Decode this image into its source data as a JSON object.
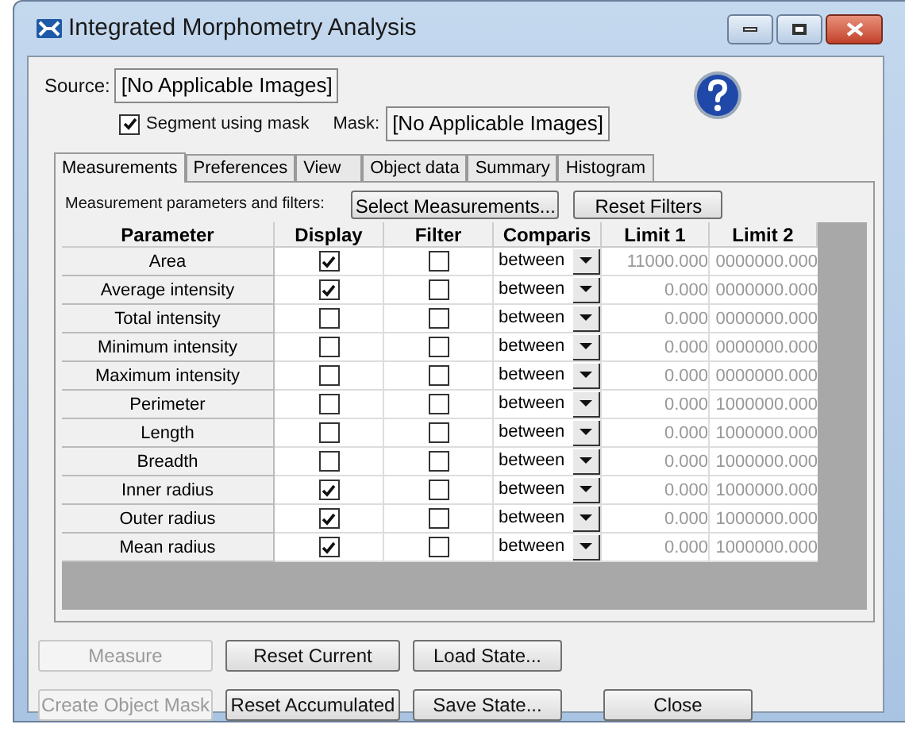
{
  "window": {
    "title": "Integrated Morphometry Analysis"
  },
  "source": {
    "label": "Source:",
    "value": "[No Applicable Images]"
  },
  "segment_using_mask": {
    "label": "Segment using mask",
    "checked": true
  },
  "mask": {
    "label": "Mask:",
    "value": "[No Applicable Images]"
  },
  "tabs": [
    {
      "label": "Measurements",
      "selected": true
    },
    {
      "label": "Preferences",
      "selected": false
    },
    {
      "label": "View",
      "selected": false
    },
    {
      "label": "Object data",
      "selected": false
    },
    {
      "label": "Summary",
      "selected": false
    },
    {
      "label": "Histogram",
      "selected": false
    }
  ],
  "table_caption": "Measurement parameters and filters:",
  "select_measurements_button": "Select Measurements...",
  "reset_filters_button": "Reset Filters",
  "table": {
    "columns": [
      "Parameter",
      "Display",
      "Filter",
      "Comparis",
      "Limit 1",
      "Limit 2"
    ],
    "rows": [
      {
        "parameter": "Area",
        "display": true,
        "filter": false,
        "comparison": "between",
        "limit_1": "11000.000",
        "limit_2": "0000000.000"
      },
      {
        "parameter": "Average intensity",
        "display": true,
        "filter": false,
        "comparison": "between",
        "limit_1": "0.000",
        "limit_2": "0000000.000"
      },
      {
        "parameter": "Total intensity",
        "display": false,
        "filter": false,
        "comparison": "between",
        "limit_1": "0.000",
        "limit_2": "0000000.000"
      },
      {
        "parameter": "Minimum intensity",
        "display": false,
        "filter": false,
        "comparison": "between",
        "limit_1": "0.000",
        "limit_2": "0000000.000"
      },
      {
        "parameter": "Maximum intensity",
        "display": false,
        "filter": false,
        "comparison": "between",
        "limit_1": "0.000",
        "limit_2": "0000000.000"
      },
      {
        "parameter": "Perimeter",
        "display": false,
        "filter": false,
        "comparison": "between",
        "limit_1": "0.000",
        "limit_2": "1000000.000"
      },
      {
        "parameter": "Length",
        "display": false,
        "filter": false,
        "comparison": "between",
        "limit_1": "0.000",
        "limit_2": "1000000.000"
      },
      {
        "parameter": "Breadth",
        "display": false,
        "filter": false,
        "comparison": "between",
        "limit_1": "0.000",
        "limit_2": "1000000.000"
      },
      {
        "parameter": "Inner radius",
        "display": true,
        "filter": false,
        "comparison": "between",
        "limit_1": "0.000",
        "limit_2": "1000000.000"
      },
      {
        "parameter": "Outer radius",
        "display": true,
        "filter": false,
        "comparison": "between",
        "limit_1": "0.000",
        "limit_2": "1000000.000"
      },
      {
        "parameter": "Mean radius",
        "display": true,
        "filter": false,
        "comparison": "between",
        "limit_1": "0.000",
        "limit_2": "1000000.000"
      }
    ]
  },
  "buttons": [
    [
      {
        "label": "Measure",
        "disabled": true
      },
      {
        "label": "Reset Current",
        "disabled": false
      },
      {
        "label": "Load State...",
        "disabled": false
      }
    ],
    [
      {
        "label": "Create Object Mask",
        "disabled": true
      },
      {
        "label": "Reset Accumulated",
        "disabled": false
      },
      {
        "label": "Save State...",
        "disabled": false
      },
      {
        "label": "Close",
        "disabled": false
      }
    ]
  ]
}
